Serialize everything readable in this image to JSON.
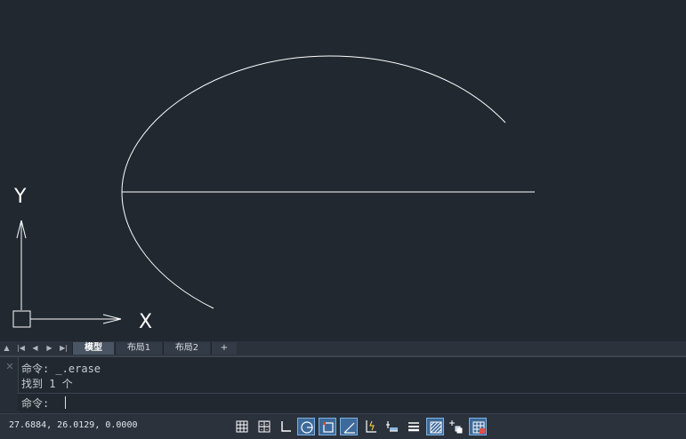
{
  "axes": {
    "x_label": "X",
    "y_label": "Y"
  },
  "layout_tabs": [
    {
      "label": "模型",
      "active": true
    },
    {
      "label": "布局1",
      "active": false
    },
    {
      "label": "布局2",
      "active": false
    },
    {
      "label": "+",
      "active": false
    }
  ],
  "command": {
    "history": [
      "命令: _.erase",
      "找到 1 个"
    ],
    "prompt": "命令: "
  },
  "status": {
    "coordinates": "27.6884, 26.0129, 0.0000",
    "toggles": [
      {
        "name": "grid-display-icon",
        "on": false
      },
      {
        "name": "snap-mode-icon",
        "on": false
      },
      {
        "name": "ortho-mode-icon",
        "on": false
      },
      {
        "name": "polar-tracking-icon",
        "on": true
      },
      {
        "name": "object-snap-icon",
        "on": true
      },
      {
        "name": "object-snap-tracking-icon",
        "on": true
      },
      {
        "name": "dynamic-ucs-icon",
        "on": false
      },
      {
        "name": "dynamic-input-icon",
        "on": false
      },
      {
        "name": "lineweight-icon",
        "on": false
      },
      {
        "name": "transparency-icon",
        "on": true
      },
      {
        "name": "selection-cycling-icon",
        "on": false
      },
      {
        "name": "annotation-monitor-icon",
        "on": true
      }
    ]
  },
  "colors": {
    "background": "#212830",
    "drawing": "#ffffff",
    "toggle_on": "#3d6a9a"
  }
}
